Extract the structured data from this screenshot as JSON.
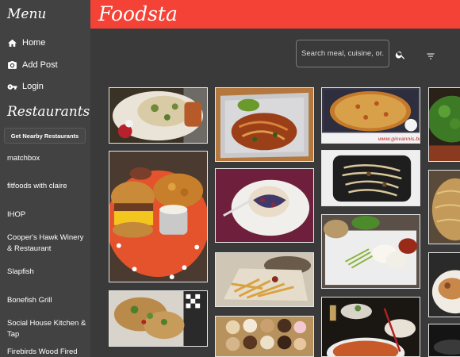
{
  "sidebar": {
    "menu_title": "Menu",
    "nav": [
      {
        "label": "Home",
        "icon": "home-icon"
      },
      {
        "label": "Add Post",
        "icon": "camera-icon"
      },
      {
        "label": "Login",
        "icon": "key-icon"
      }
    ],
    "restaurants_title": "Restaurants",
    "restaurants_icon": "fork-knife-icon",
    "nearby_button": "Get Nearby Restaurants",
    "restaurants": [
      "matchbox",
      "fitfoods with claire",
      "IHOP",
      "Cooper's Hawk Winery & Restaurant",
      "Slapfish",
      "Bonefish Grill",
      "Social House Kitchen & Tap",
      "Firebirds Wood Fired"
    ]
  },
  "header": {
    "brand": "Foodsta",
    "color": "#f44336"
  },
  "search": {
    "placeholder": "Search meal, cuisine, or...",
    "search_icon": "search-icon",
    "filter_icon": "filter-icon"
  },
  "feed": {
    "photos": [
      {
        "id": "nachos-plate"
      },
      {
        "id": "noodles-foil-tray"
      },
      {
        "id": "giovannis-pizza",
        "caption": "www.giovannis.biz"
      },
      {
        "id": "salad-greens"
      },
      {
        "id": "bagel-burger-fries"
      },
      {
        "id": "pastry-plate"
      },
      {
        "id": "noodles-black-container"
      },
      {
        "id": "fries-tray"
      },
      {
        "id": "rice-dumplings"
      },
      {
        "id": "tacos-checkered"
      },
      {
        "id": "donut-box"
      },
      {
        "id": "pho-bowls"
      },
      {
        "id": "noodles-side"
      },
      {
        "id": "plate-side"
      },
      {
        "id": "dark-side"
      }
    ]
  }
}
